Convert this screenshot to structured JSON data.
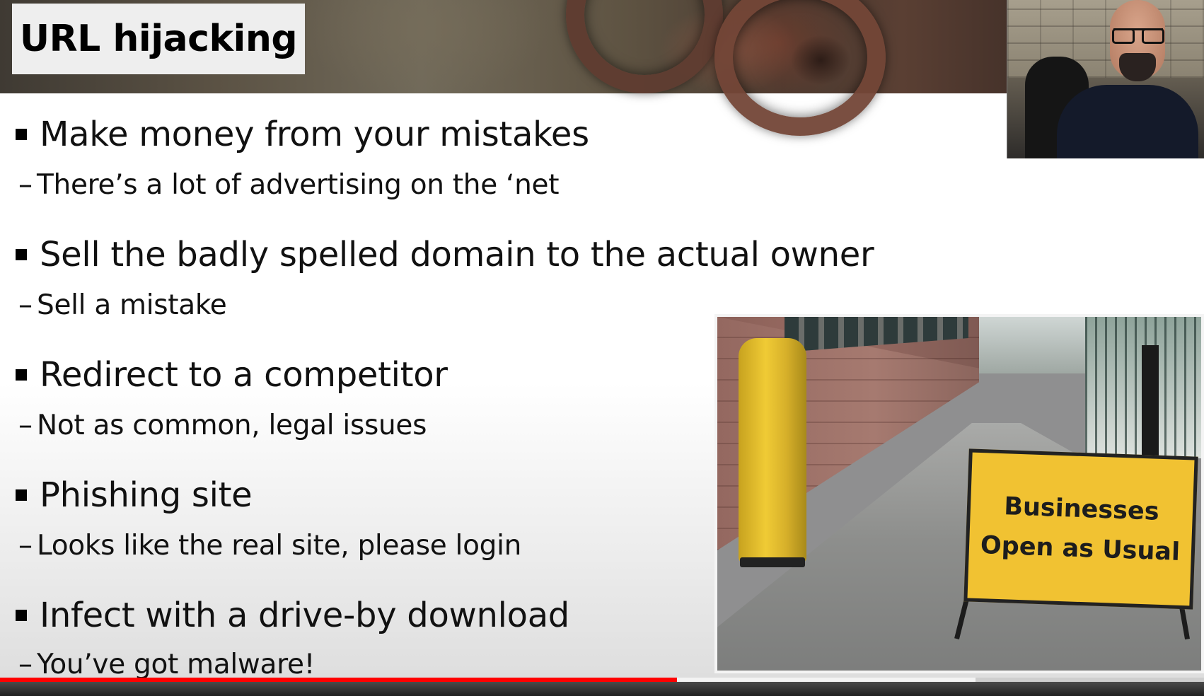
{
  "slide": {
    "title": "URL hijacking",
    "bullets": [
      {
        "text": "Make money from your mistakes",
        "sub": "There’s a lot of advertising on the ‘net"
      },
      {
        "text": "Sell the badly spelled domain to the actual owner",
        "sub": "Sell a mistake"
      },
      {
        "text": "Redirect to a competitor",
        "sub": "Not as common, legal issues"
      },
      {
        "text": "Phishing site",
        "sub": "Looks like the real site, please login"
      },
      {
        "text": "Infect with a drive-by download",
        "sub": "You’ve got malware!"
      }
    ],
    "sub_dash": "–",
    "photo": {
      "sign_lines": [
        "Businesses",
        "Open as Usual"
      ]
    }
  },
  "player": {
    "progress_fraction": 0.562,
    "buffered_fraction": 0.81,
    "progress_color": "#ff0000"
  },
  "colors": {
    "title_box": "#eeeeee",
    "sign": "#f1c232",
    "text": "#111111"
  },
  "icons": {
    "bullet_marker": "square-bullet-icon"
  }
}
